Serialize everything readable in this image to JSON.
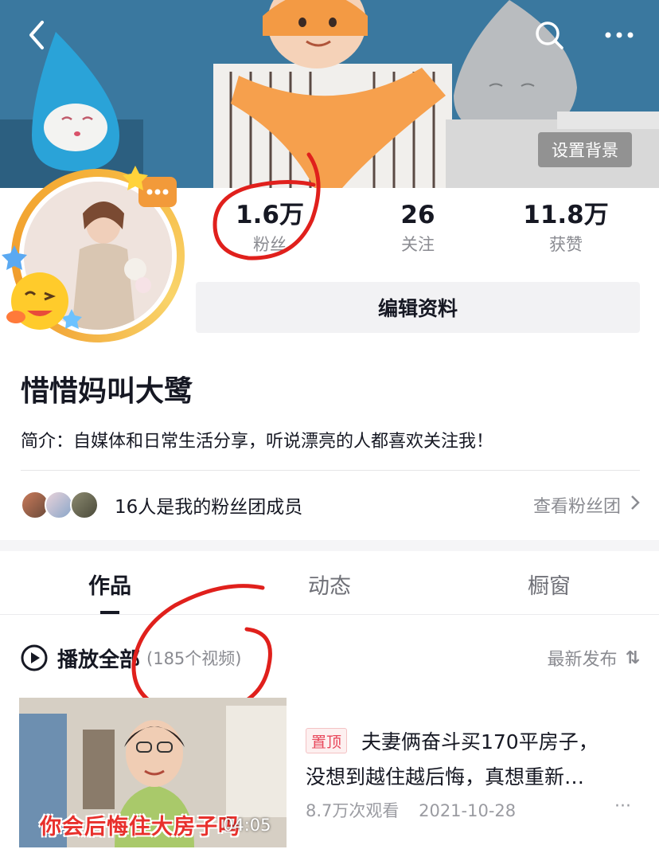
{
  "header": {
    "set_background_label": "设置背景"
  },
  "stats": [
    {
      "value": "1.6万",
      "label": "粉丝"
    },
    {
      "value": "26",
      "label": "关注"
    },
    {
      "value": "11.8万",
      "label": "获赞"
    }
  ],
  "edit_profile_label": "编辑资料",
  "profile": {
    "nickname": "惜惜妈叫大鹭",
    "bio": "简介：自媒体和日常生活分享，听说漂亮的人都喜欢关注我！"
  },
  "fan_group": {
    "text": "16人是我的粉丝团成员",
    "link_label": "查看粉丝团"
  },
  "tabs": [
    {
      "label": "作品",
      "active": true
    },
    {
      "label": "动态",
      "active": false
    },
    {
      "label": "橱窗",
      "active": false
    }
  ],
  "playlist": {
    "play_all_label": "播放全部",
    "count_label": "(185个视频)",
    "sort_label": "最新发布",
    "sort_icon": "⇅"
  },
  "video": {
    "thumb_caption": "你会后悔住大房子吗",
    "duration": "04:05",
    "pin_badge": "置顶",
    "title_line1": "夫妻俩奋斗买170平房子，",
    "title_line2": "没想到越住越后悔，真想重新…",
    "views": "8.7万次观看",
    "date": "2021-10-28",
    "more": "···"
  },
  "colors": {
    "annotation_red": "#e0201c",
    "pin_red": "#e8475b",
    "muted_text": "#8a8b91"
  }
}
